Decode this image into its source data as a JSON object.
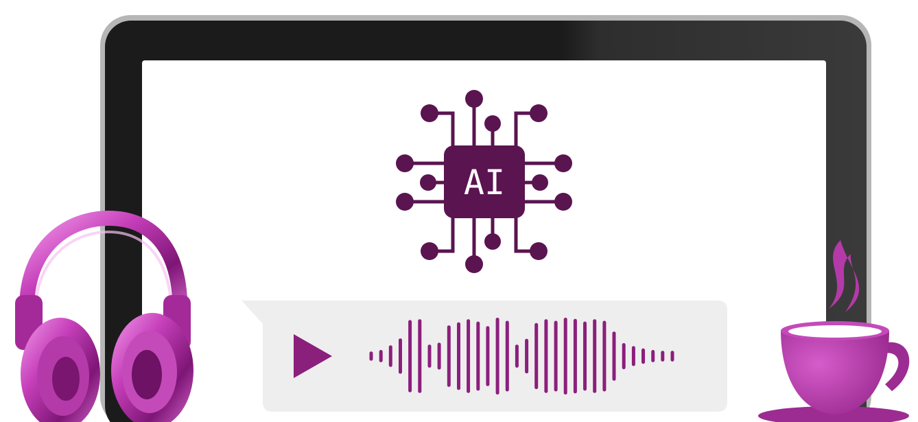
{
  "chip": {
    "label": "AI"
  },
  "colors": {
    "accent": "#5a1450",
    "wave": "#8b1f7c",
    "bubble": "#efeeee",
    "frame": "#1c1c1c",
    "magenta": "#c04bb8",
    "cup": "#c44ab9"
  },
  "icons": {
    "play": "play-icon",
    "headphones": "headphones-icon",
    "cup": "coffee-cup-icon",
    "chip": "ai-chip-icon"
  },
  "audio": {
    "bars": [
      0.12,
      0.16,
      0.28,
      0.46,
      0.94,
      0.96,
      0.3,
      0.35,
      0.8,
      0.88,
      0.96,
      0.9,
      0.78,
      1.0,
      0.92,
      0.3,
      0.45,
      0.86,
      0.96,
      0.92,
      1.0,
      0.97,
      0.9,
      0.96,
      0.92,
      0.64,
      0.34,
      0.26,
      0.2,
      0.16,
      0.14,
      0.14
    ]
  }
}
